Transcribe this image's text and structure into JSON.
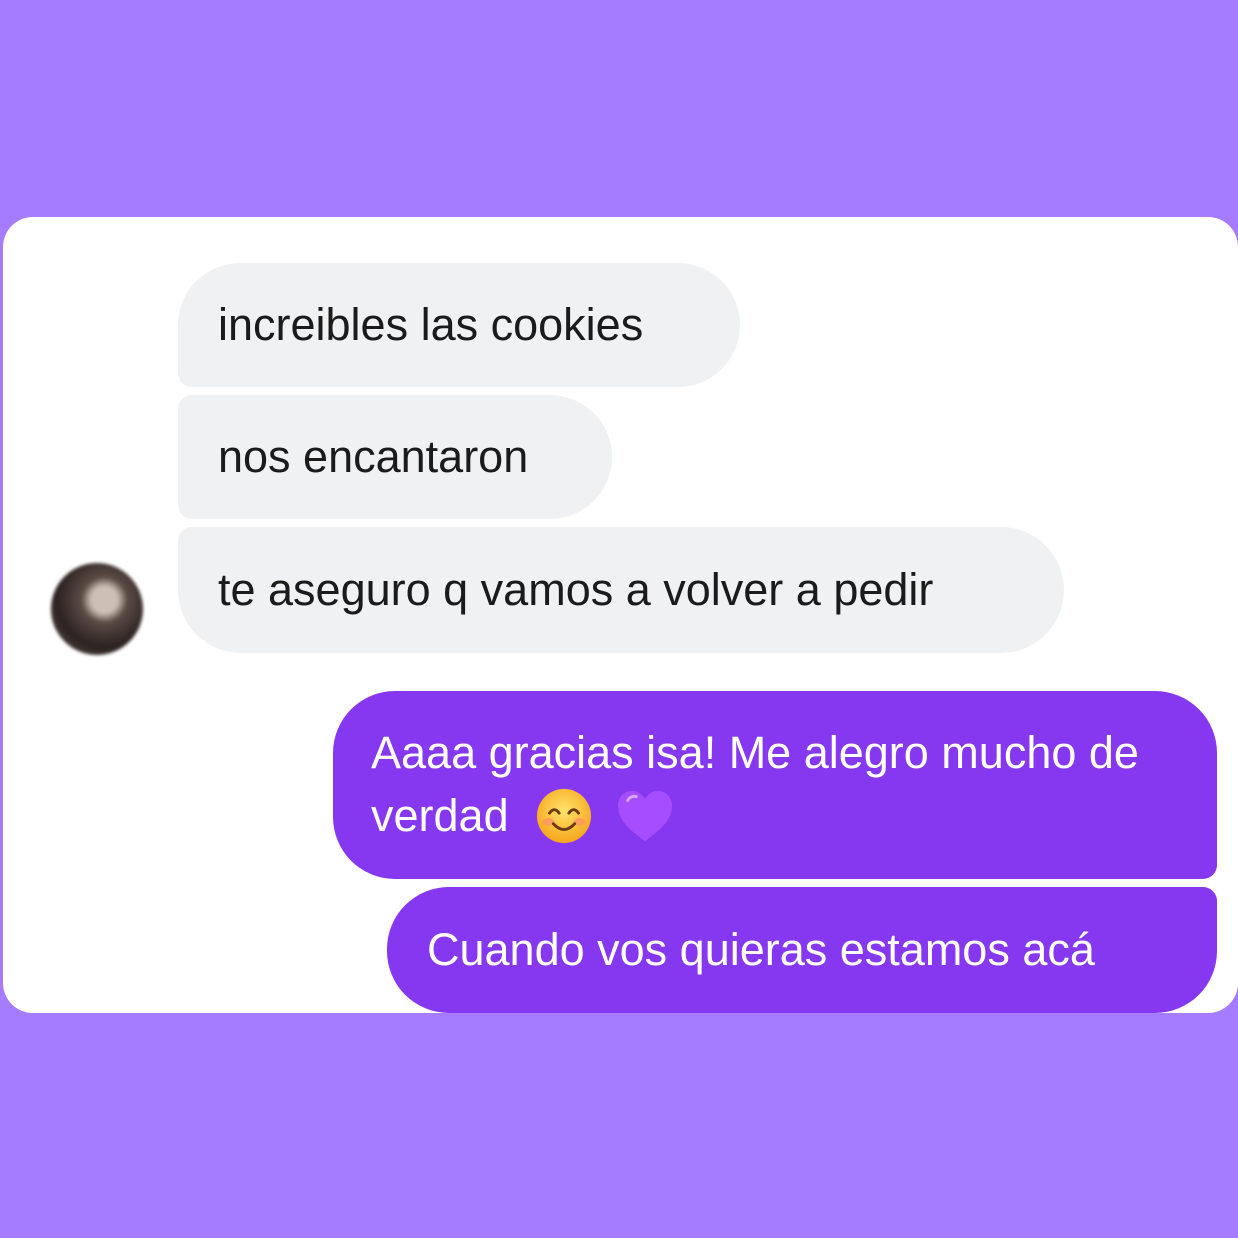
{
  "conversation": {
    "incoming": [
      {
        "text": "increibles las cookies"
      },
      {
        "text": "nos encantaron"
      },
      {
        "text": "te aseguro q vamos a volver a pedir"
      }
    ],
    "outgoing": [
      {
        "text": "Aaaa gracias isa! Me alegro mucho de verdad",
        "emoji": [
          "smiling-face-icon",
          "purple-heart-icon"
        ]
      },
      {
        "text": "Cuando vos quieras estamos acá"
      }
    ]
  },
  "colors": {
    "page_background": "#a57bff",
    "card_background": "#ffffff",
    "incoming_bubble": "#f0f1f3",
    "outgoing_bubble": "#8637f0"
  }
}
